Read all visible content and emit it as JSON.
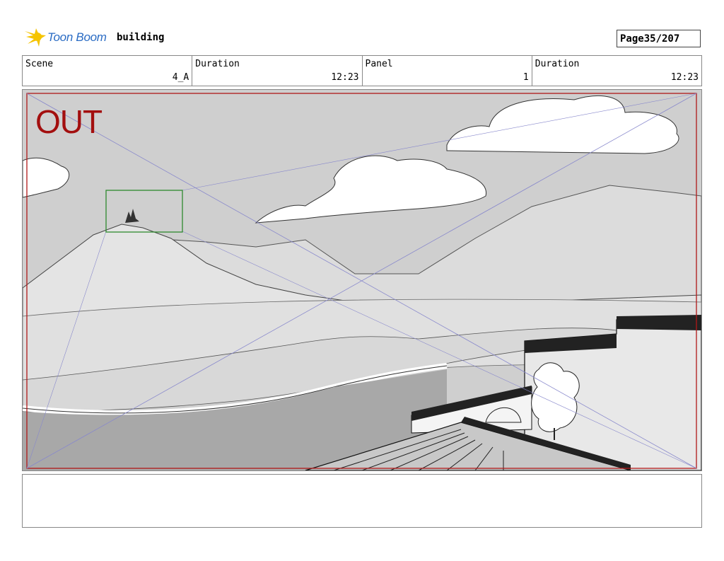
{
  "header": {
    "brand": "Toon Boom",
    "project_title": "building",
    "page_label": "Page",
    "page_value": "35/207"
  },
  "info": {
    "scene_label": "Scene",
    "scene_value": "4_A",
    "duration_label": "Duration",
    "duration_value": "12:23",
    "panel_label": "Panel",
    "panel_value": "1",
    "panel_duration_label": "Duration",
    "panel_duration_value": "12:23"
  },
  "panel": {
    "camera_label": "OUT"
  },
  "notes": {
    "text": ""
  },
  "colors": {
    "logo_blue": "#2b6cc4",
    "logo_yellow": "#f5c400",
    "safe_frame_red": "#b01818",
    "camera_green": "#2e8b2e",
    "guide_line_blue": "#8888cc"
  }
}
